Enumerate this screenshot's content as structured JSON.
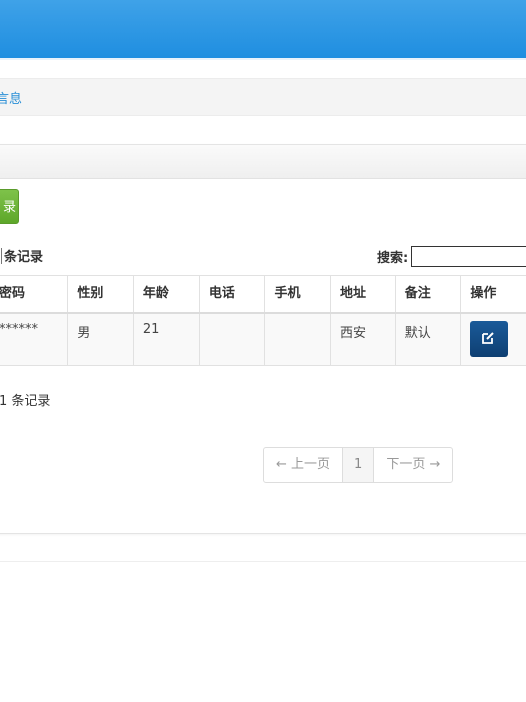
{
  "breadcrumb": {
    "current": "言息"
  },
  "toolbar": {
    "add_label": "录"
  },
  "table_controls": {
    "length_suffix": "条记录",
    "search_label": "搜索:",
    "search_value": ""
  },
  "table": {
    "columns": [
      "密码",
      "性别",
      "年龄",
      "电话",
      "手机",
      "地址",
      "备注",
      "操作"
    ],
    "rows": [
      {
        "password": "******",
        "gender": "男",
        "age": "21",
        "phone": "",
        "mobile": "",
        "address": "西安",
        "note": "默认",
        "action_icon": "edit-icon"
      }
    ]
  },
  "info_text": "1 条记录",
  "pagination": {
    "prev": "← 上一页",
    "current": "1",
    "next": "下一页 →"
  },
  "colors": {
    "topbar": "#2196e3",
    "add_button": "#6cb33e",
    "edit_button": "#0f3f73",
    "link": "#2a8fd6"
  }
}
